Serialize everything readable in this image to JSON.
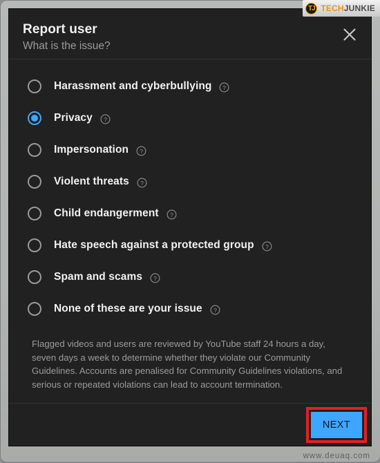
{
  "window": {
    "watermark_logo": {
      "badge_text": "TJ",
      "word_one": "TECH",
      "word_two": "JUNKIE"
    },
    "footer_watermark": "www.deuaq.com"
  },
  "dialog": {
    "title": "Report user",
    "subtitle": "What is the issue?",
    "close_icon": "close-icon",
    "options": [
      {
        "label": "Harassment and cyberbullying",
        "selected": false,
        "help_icon": "help-circle-icon"
      },
      {
        "label": "Privacy",
        "selected": true,
        "help_icon": "help-circle-icon"
      },
      {
        "label": "Impersonation",
        "selected": false,
        "help_icon": "help-circle-icon"
      },
      {
        "label": "Violent threats",
        "selected": false,
        "help_icon": "help-circle-icon"
      },
      {
        "label": "Child endangerment",
        "selected": false,
        "help_icon": "help-circle-icon"
      },
      {
        "label": "Hate speech against a protected group",
        "selected": false,
        "help_icon": "help-circle-icon"
      },
      {
        "label": "Spam and scams",
        "selected": false,
        "help_icon": "help-circle-icon"
      },
      {
        "label": "None of these are your issue",
        "selected": false,
        "help_icon": "help-circle-icon"
      }
    ],
    "disclaimer": "Flagged videos and users are reviewed by YouTube staff 24 hours a day, seven days a week to determine whether they violate our Community Guidelines. Accounts are penalised for Community Guidelines violations, and serious or repeated violations can lead to account termination.",
    "next_label": "NEXT"
  },
  "colors": {
    "accent_blue": "#3ea6ff",
    "dialog_background": "#212121",
    "frame_gray": "#b2b4b3",
    "annotation_red": "#e41f1f",
    "logo_orange": "#e8971a"
  }
}
